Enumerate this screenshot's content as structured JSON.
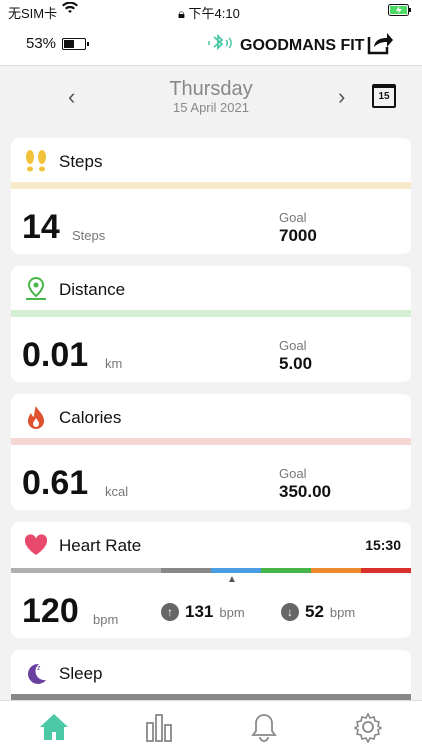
{
  "status_bar": {
    "carrier": "无SIM卡",
    "time": "下午4:10"
  },
  "header": {
    "battery_pct": "53%",
    "battery_level": 0.53,
    "brand": "GOODMANS FIT"
  },
  "date": {
    "day": "Thursday",
    "date": "15 April 2021",
    "calendar_day": "15"
  },
  "cards": {
    "steps": {
      "title": "Steps",
      "value": "14",
      "unit": "Steps",
      "goal_label": "Goal",
      "goal": "7000",
      "color": "#f7e9c9",
      "icon_color": "#f2c33a"
    },
    "distance": {
      "title": "Distance",
      "value": "0.01",
      "unit": "km",
      "goal_label": "Goal",
      "goal": "5.00",
      "color": "#d4efd1",
      "icon_color": "#47b649"
    },
    "calories": {
      "title": "Calories",
      "value": "0.61",
      "unit": "kcal",
      "goal_label": "Goal",
      "goal": "350.00",
      "color": "#f6d6d3",
      "icon_color": "#e0522f"
    },
    "heart_rate": {
      "title": "Heart Rate",
      "time": "15:30",
      "value": "120",
      "unit": "bpm",
      "max": "131",
      "max_unit": "bpm",
      "min": "52",
      "min_unit": "bpm",
      "icon_color": "#e84a6b"
    },
    "sleep": {
      "title": "Sleep",
      "icon_color": "#6a3fa0"
    }
  },
  "colors": {
    "accent": "#4bc8a6"
  }
}
